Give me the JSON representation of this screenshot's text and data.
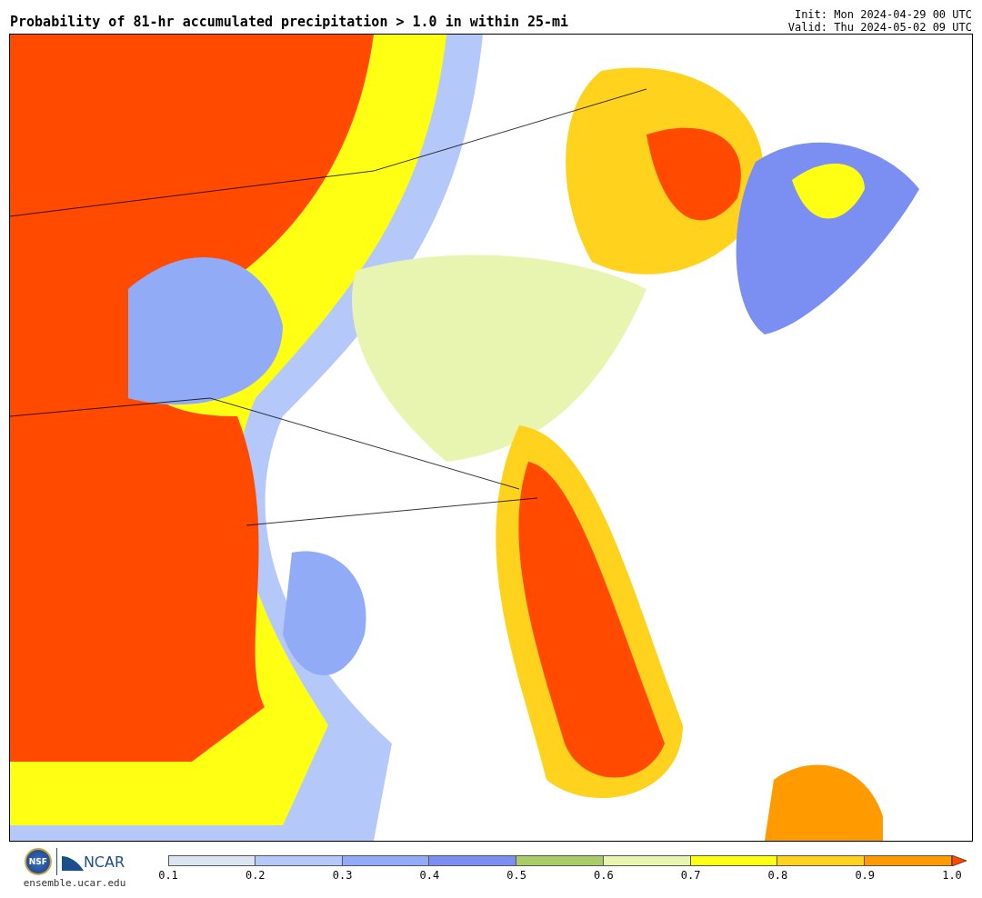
{
  "title": "Probability of 81-hr accumulated precipitation > 1.0 in within 25-mi",
  "init": "Init: Mon 2024-04-29 00 UTC",
  "valid": "Valid: Thu 2024-05-02 09 UTC",
  "logos": [
    {
      "kind": "seal",
      "text": "NSF"
    },
    {
      "kind": "wordmark",
      "text": "NCAR"
    }
  ],
  "url": "ensemble.ucar.edu",
  "colorbar": {
    "bins": [
      {
        "color": "#dbe5f1"
      },
      {
        "color": "#b4c9fa"
      },
      {
        "color": "#91abf7"
      },
      {
        "color": "#7b8ff2"
      },
      {
        "color": "#a8cc68"
      },
      {
        "color": "#e8f5b0"
      },
      {
        "color": "#ffff14"
      },
      {
        "color": "#ffd21e"
      },
      {
        "color": "#ff9a00"
      }
    ],
    "extend": {
      "color": "#ff4a00"
    },
    "ticks": [
      "0.1",
      "0.2",
      "0.3",
      "0.4",
      "0.5",
      "0.6",
      "0.7",
      "0.8",
      "0.9",
      "1.0"
    ]
  }
}
